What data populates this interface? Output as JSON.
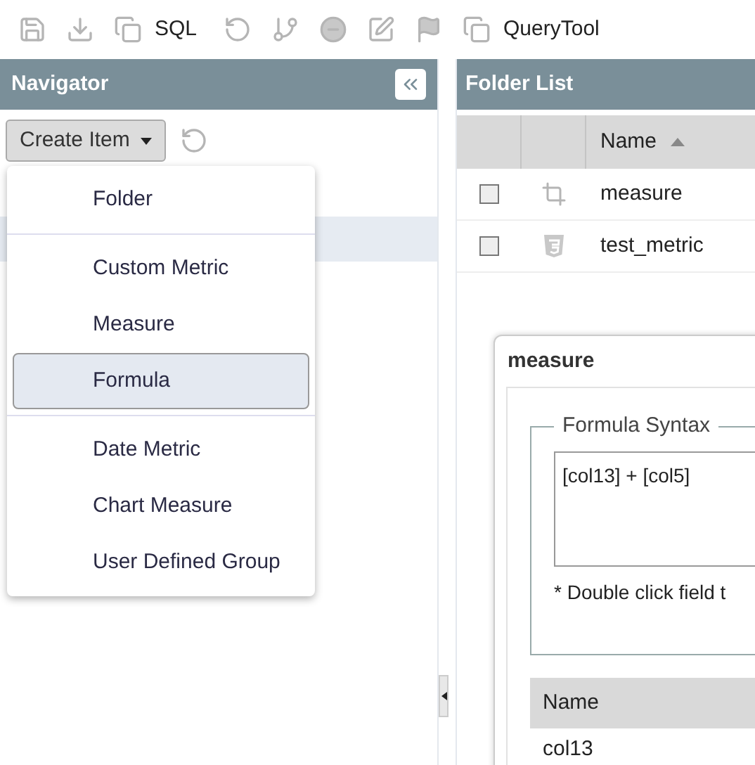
{
  "toolbar": {
    "sql_label": "SQL",
    "query_tool_label": "QueryTool"
  },
  "navigator": {
    "title": "Navigator",
    "create_button": "Create Item",
    "menu_open": true,
    "menu_groups": [
      [
        {
          "label": "Folder",
          "selected": false
        }
      ],
      [
        {
          "label": "Custom Metric",
          "selected": false
        },
        {
          "label": "Measure",
          "selected": false
        },
        {
          "label": "Formula",
          "selected": true
        }
      ],
      [
        {
          "label": "Date Metric",
          "selected": false
        },
        {
          "label": "Chart Measure",
          "selected": false
        },
        {
          "label": "User Defined Group",
          "selected": false
        }
      ]
    ]
  },
  "folder_list": {
    "title": "Folder List",
    "name_column": "Name",
    "rows": [
      {
        "name": "measure",
        "kind": "measure",
        "checked": false
      },
      {
        "name": "test_metric",
        "kind": "metric",
        "checked": false
      }
    ]
  },
  "dialog": {
    "title": "measure",
    "legend": "Formula Syntax",
    "formula": "[col13] + [col5]",
    "hint": "* Double click field t",
    "table_header": "Name",
    "rows": [
      "col13"
    ]
  }
}
